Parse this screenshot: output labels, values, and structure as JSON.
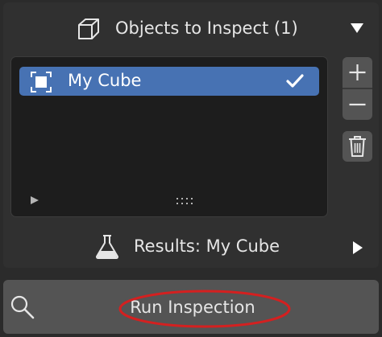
{
  "objects_section": {
    "title": "Objects to Inspect (1)",
    "header_icon": "cube-icon",
    "toggle_icon": "triangle-down-icon"
  },
  "object_list": {
    "items": [
      {
        "label": "My Cube",
        "icon": "object-selection-icon",
        "checked": true,
        "selected": true
      }
    ],
    "expand_icon": "triangle-right-small-icon",
    "grip_icon": "resize-grip-icon"
  },
  "side_buttons": {
    "add_icon": "plus-icon",
    "remove_icon": "minus-icon",
    "clear_icon": "trash-icon"
  },
  "results_section": {
    "title": "Results: My Cube",
    "header_icon": "flask-icon",
    "toggle_icon": "triangle-right-icon"
  },
  "run_button": {
    "label": "Run Inspection",
    "icon": "search-icon",
    "annotation": "red-oval-highlight"
  },
  "colors": {
    "background": "#2b2b2b",
    "panel": "#303030",
    "list_bg": "#1d1d1d",
    "selected_item": "#4772b3",
    "button": "#545454",
    "text": "#e6e6e6",
    "annotation_red": "#d42020"
  }
}
